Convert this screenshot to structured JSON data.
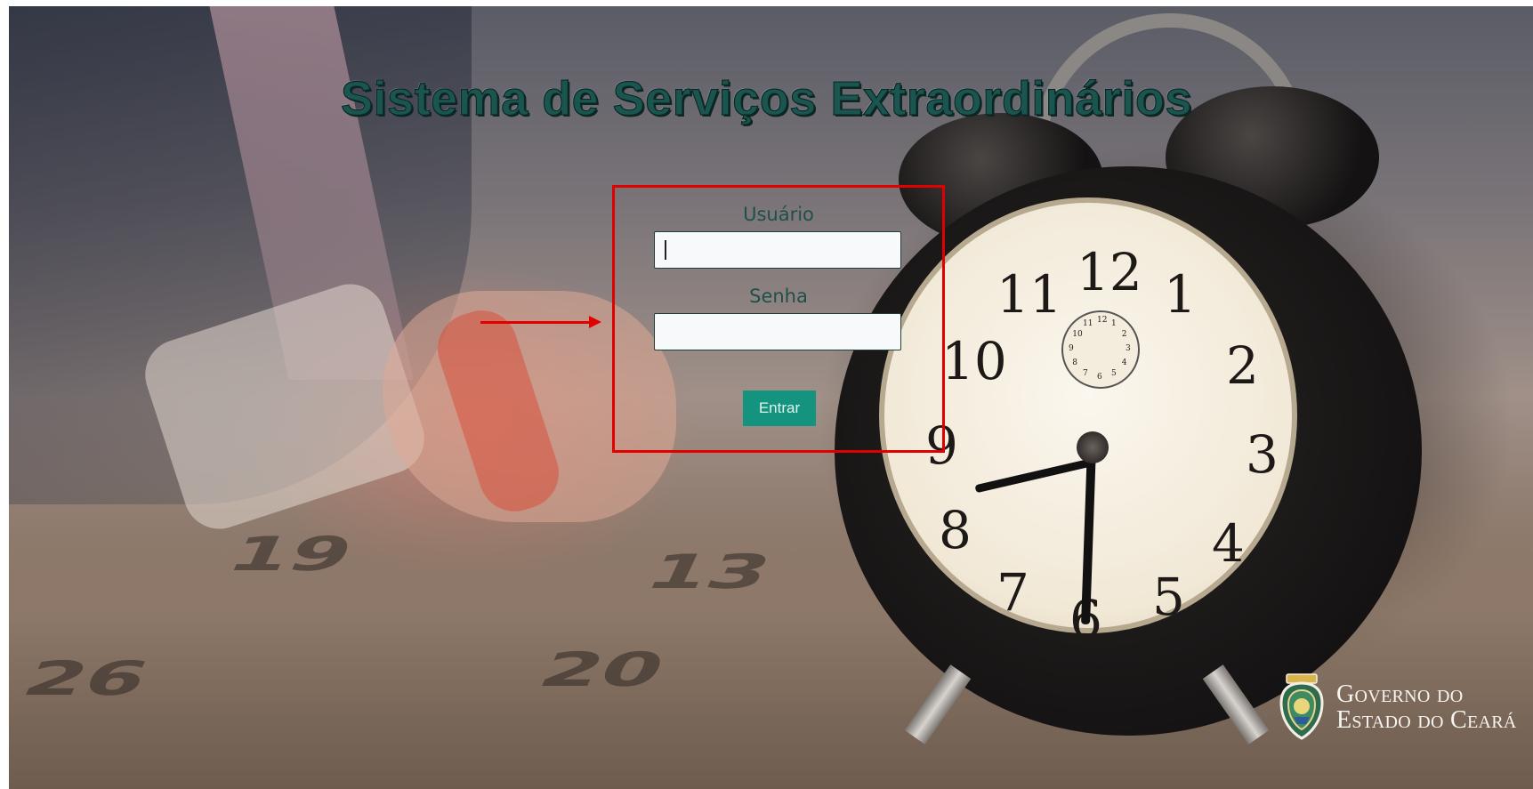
{
  "page": {
    "title": "Sistema de Serviços Extraordinários"
  },
  "login": {
    "username_label": "Usuário",
    "username_value": "",
    "password_label": "Senha",
    "password_value": "",
    "submit_label": "Entrar"
  },
  "background": {
    "calendar_numbers": [
      "19",
      "13",
      "26",
      "20"
    ],
    "clock_numerals": [
      "12",
      "1",
      "2",
      "3",
      "4",
      "5",
      "6",
      "7",
      "8",
      "9",
      "10",
      "11"
    ],
    "sub_dial_numerals": [
      "12",
      "1",
      "2",
      "3",
      "4",
      "5",
      "6",
      "7",
      "8",
      "9",
      "10",
      "11"
    ]
  },
  "footer": {
    "logo_line1": "Governo do",
    "logo_line2": "Estado do Ceará"
  },
  "colors": {
    "title": "#1b5550",
    "button": "#14937f",
    "highlight": "#e00000"
  },
  "icons": {
    "annotation_arrow": "arrow-right-icon",
    "logo": "coat-of-arms-icon"
  }
}
